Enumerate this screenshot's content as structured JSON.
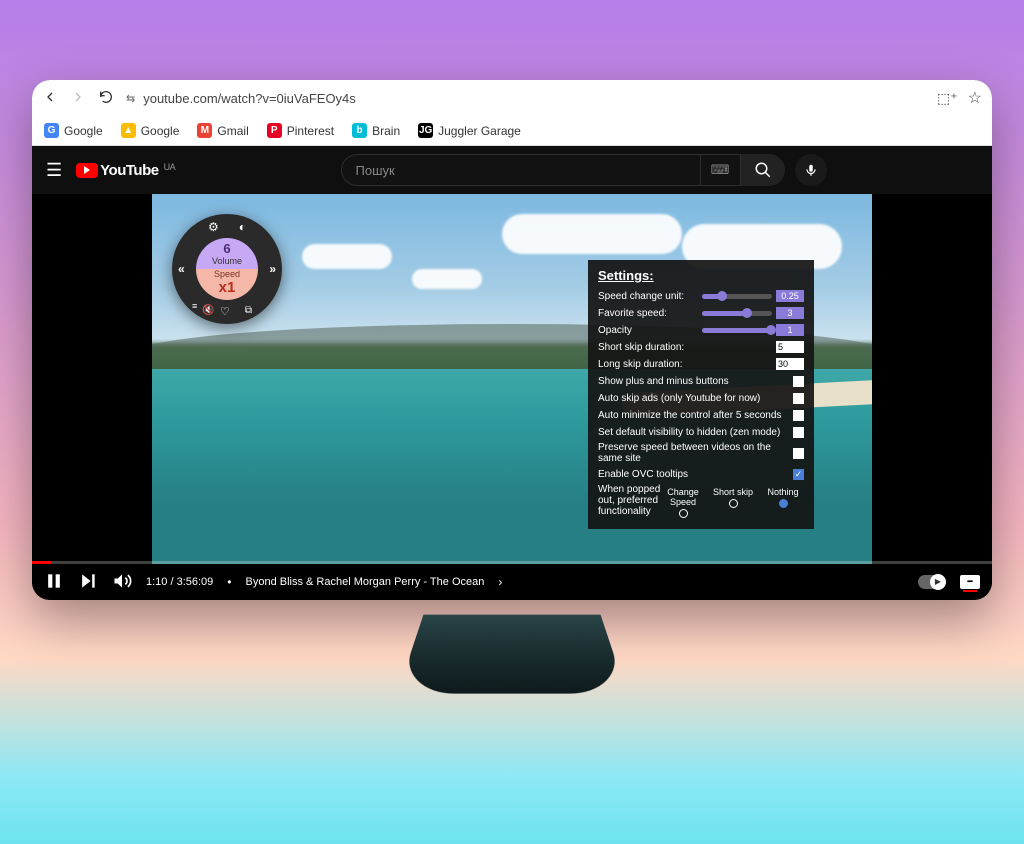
{
  "browser": {
    "url": "youtube.com/watch?v=0iuVaFEOy4s",
    "bookmarks": [
      {
        "label": "Google",
        "color": "#4285f4",
        "letter": "G"
      },
      {
        "label": "Google",
        "color": "#fbbc04",
        "letter": "▲"
      },
      {
        "label": "Gmail",
        "color": "#ea4335",
        "letter": "M"
      },
      {
        "label": "Pinterest",
        "color": "#e60023",
        "letter": "P"
      },
      {
        "label": "Brain",
        "color": "#00bcd4",
        "letter": "b"
      },
      {
        "label": "Juggler Garage",
        "color": "#000",
        "letter": "JG"
      }
    ]
  },
  "youtube": {
    "brand": "YouTube",
    "region": "UA",
    "search_placeholder": "Пошук"
  },
  "ovc": {
    "volume_label": "Volume",
    "volume_value": "6",
    "speed_label": "Speed",
    "speed_value": "x1"
  },
  "settings": {
    "title": "Settings:",
    "speed_change_unit": {
      "label": "Speed change unit:",
      "value": "0.25",
      "pct": 25
    },
    "favorite_speed": {
      "label": "Favorite speed:",
      "value": "3",
      "pct": 60
    },
    "opacity": {
      "label": "Opacity",
      "value": "1",
      "pct": 95
    },
    "short_skip": {
      "label": "Short skip duration:",
      "value": "5"
    },
    "long_skip": {
      "label": "Long skip duration:",
      "value": "30"
    },
    "show_pm": {
      "label": "Show plus and minus buttons",
      "checked": false
    },
    "auto_skip_ads": {
      "label": "Auto skip ads (only Youtube for now)",
      "checked": false
    },
    "auto_min": {
      "label": "Auto minimize the control after 5 seconds",
      "checked": false
    },
    "zen": {
      "label": "Set default visibility to hidden (zen mode)",
      "checked": false
    },
    "preserve": {
      "label": "Preserve speed between videos on the same site",
      "checked": false
    },
    "tooltips": {
      "label": "Enable OVC tooltips",
      "checked": true
    },
    "popped": {
      "label": "When popped out, preferred functionality",
      "options": [
        "Change Speed",
        "Short skip",
        "Nothing"
      ],
      "selected": 2
    }
  },
  "player": {
    "current_time": "1:10",
    "total_time": "3:56:09",
    "title": "Byond Bliss & Rachel Morgan Perry - The Ocean"
  }
}
